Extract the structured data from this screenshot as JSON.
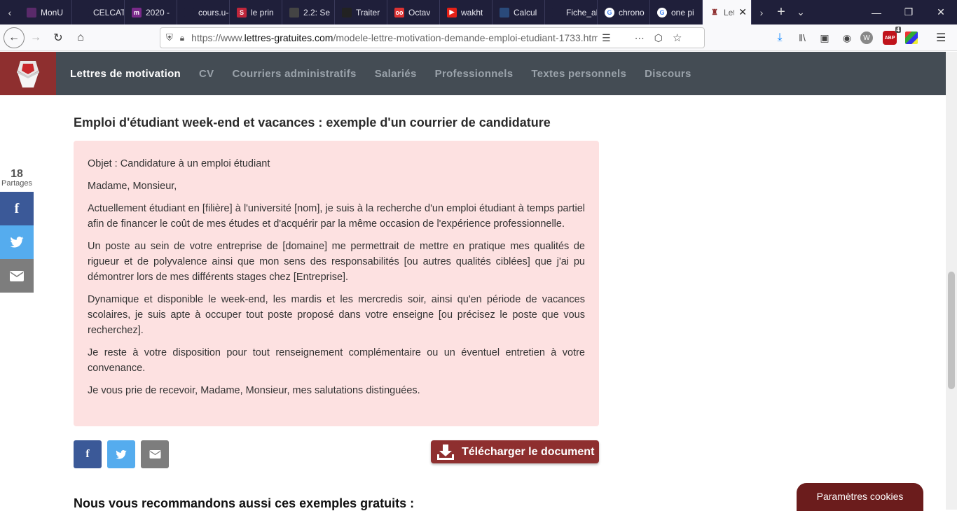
{
  "browser": {
    "tabs": [
      {
        "label": "MonU",
        "fav": "",
        "color": "#5a2a6a"
      },
      {
        "label": "CELCAT Ca",
        "fav": "",
        "color": "#1f1f3a"
      },
      {
        "label": "2020 -",
        "fav": "m",
        "color": "#7a2a8a"
      },
      {
        "label": "cours.u-ce",
        "fav": "",
        "color": "#1f1f3a"
      },
      {
        "label": "le prin",
        "fav": "S",
        "color": "#c0263b"
      },
      {
        "label": "2.2: Se",
        "fav": "",
        "color": "#444"
      },
      {
        "label": "Traiter",
        "fav": "",
        "color": "#222"
      },
      {
        "label": "Octav",
        "fav": "oo",
        "color": "#d33"
      },
      {
        "label": "wakht",
        "fav": "▶",
        "color": "#e62117"
      },
      {
        "label": "Calcul",
        "fav": "",
        "color": "#2a4a7a"
      },
      {
        "label": "Fiche_algo",
        "fav": "",
        "color": "#1f1f3a"
      },
      {
        "label": "chrono",
        "fav": "G",
        "color": "#fff"
      },
      {
        "label": "one pi",
        "fav": "G",
        "color": "#fff"
      }
    ],
    "active_tab": {
      "label": "Let"
    },
    "url_prefix": "https://www.",
    "url_domain": "lettres-gratuites.com",
    "url_path": "/modele-lettre-motivation-demande-emploi-etudiant-1733.htm",
    "abp_badge": "4"
  },
  "site": {
    "nav": [
      {
        "label": "Lettres de motivation",
        "active": true
      },
      {
        "label": "CV"
      },
      {
        "label": "Courriers administratifs"
      },
      {
        "label": "Salariés"
      },
      {
        "label": "Professionnels"
      },
      {
        "label": "Textes personnels"
      },
      {
        "label": "Discours"
      }
    ]
  },
  "page": {
    "heading": "Emploi d'étudiant week-end et vacances : exemple d'un courrier de candidature",
    "letter": [
      "Objet : Candidature à un emploi étudiant",
      "Madame, Monsieur,",
      "Actuellement étudiant en [filière] à l'université [nom], je suis à la recherche d'un emploi étudiant à temps partiel afin de financer le coût de mes études et d'acquérir par la même occasion de l'expérience professionnelle.",
      "Un poste au sein de votre entreprise de [domaine] me permettrait de mettre en pratique mes qualités de rigueur et de polyvalence ainsi que mon sens des responsabilités [ou autres qualités ciblées] que j'ai pu démontrer lors de mes différents stages chez [Entreprise].",
      "Dynamique et disponible le week-end, les mardis et les mercredis soir, ainsi qu'en période de vacances scolaires, je suis apte à occuper tout poste proposé dans votre enseigne [ou précisez le poste que vous recherchez].",
      "Je reste à votre disposition pour tout renseignement complémentaire ou un éventuel entretien à votre convenance.",
      "Je vous prie de recevoir, Madame, Monsieur, mes salutations distinguées."
    ],
    "share_count": "18",
    "share_label": "Partages",
    "download_label": "Télécharger le document",
    "recommend": "Nous vous recommandons aussi ces exemples gratuits :",
    "cookies_label": "Paramètres cookies"
  },
  "colors": {
    "facebook": "#3b5998",
    "twitter": "#55acee",
    "email": "#7d7d7d",
    "brand": "#8e2f2f"
  }
}
